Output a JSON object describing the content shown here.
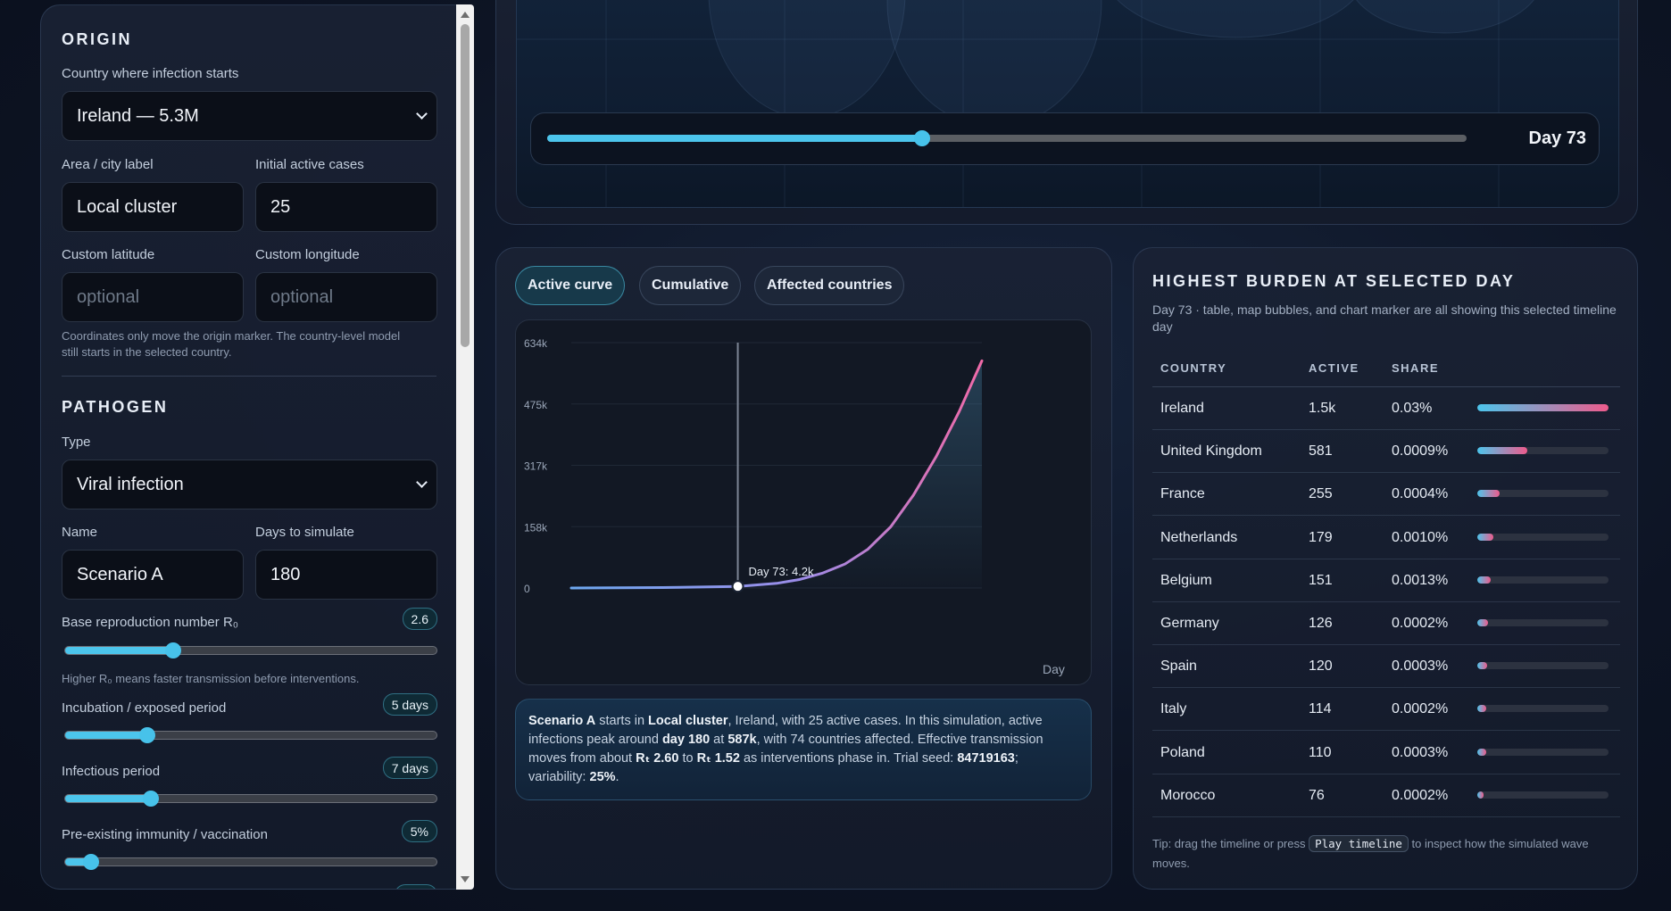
{
  "origin": {
    "title": "ORIGIN",
    "country_label": "Country where infection starts",
    "country_value": "Ireland — 5.3M",
    "area_label": "Area / city label",
    "area_value": "Local cluster",
    "cases_label": "Initial active cases",
    "cases_value": "25",
    "lat_label": "Custom latitude",
    "lat_placeholder": "optional",
    "lon_label": "Custom longitude",
    "lon_placeholder": "optional",
    "hint_line1": "Coordinates only move the origin marker. The country-level model",
    "hint_line2": "still starts in the selected country."
  },
  "pathogen": {
    "title": "PATHOGEN",
    "type_label": "Type",
    "type_value": "Viral infection",
    "name_label": "Name",
    "name_value": "Scenario A",
    "days_label": "Days to simulate",
    "days_value": "180",
    "r0_label": "Base reproduction number R₀",
    "r0_value": "2.6",
    "r0_fraction": 0.29,
    "r0_hint": "Higher R₀ means faster transmission before interventions.",
    "incubation_label": "Incubation / exposed period",
    "incubation_value": "5 days",
    "incubation_fraction": 0.22,
    "infectious_label": "Infectious period",
    "infectious_value": "7 days",
    "infectious_fraction": 0.23,
    "immunity_label": "Pre-existing immunity / vaccination",
    "immunity_value": "5%",
    "immunity_fraction": 0.07
  },
  "timeline": {
    "day_label": "Day 73",
    "fraction": 0.408
  },
  "tabs": [
    "Active curve",
    "Cumulative",
    "Affected countries"
  ],
  "chart_data": {
    "type": "line",
    "x": [
      0,
      20,
      40,
      60,
      73,
      90,
      100,
      110,
      120,
      130,
      140,
      150,
      160,
      170,
      180
    ],
    "values": [
      0,
      400,
      1200,
      2800,
      4200,
      12000,
      22000,
      38000,
      62000,
      100000,
      158000,
      240000,
      340000,
      455000,
      587000
    ],
    "yticks": [
      "634k",
      "475k",
      "317k",
      "158k",
      "0"
    ],
    "ylim": [
      0,
      634000
    ],
    "xlim": [
      0,
      180
    ],
    "xlabel": "Day",
    "marker_day": 73,
    "marker_label": "Day 73: 4.2k",
    "line_color_start": "#6ea8f0",
    "line_color_end": "#f06aa8"
  },
  "summary": {
    "scenario": "Scenario A",
    "t1": " starts in ",
    "area": "Local cluster",
    "t2": ", Ireland, with 25 active cases. In this simulation, active infections peak around ",
    "peak_day": "day 180",
    "t3": " at ",
    "peak_value": "587k",
    "t4": ", with 74 countries affected. Effective transmission moves from about ",
    "r_start": "Rₜ 2.60",
    "t5": " to ",
    "r_end": "Rₜ 1.52",
    "t6": " as interventions phase in. Trial seed: ",
    "seed": "84719163",
    "t7": "; variability: ",
    "variability": "25%",
    "t8": "."
  },
  "burden": {
    "title": "HIGHEST BURDEN AT SELECTED DAY",
    "subtitle": "Day 73 · table, map bubbles, and chart marker are all showing this selected timeline day",
    "col_country": "COUNTRY",
    "col_active": "ACTIVE",
    "col_share": "SHARE",
    "rows": [
      {
        "country": "Ireland",
        "active": "1.5k",
        "share": "0.03%",
        "bar": 1.0
      },
      {
        "country": "United Kingdom",
        "active": "581",
        "share": "0.0009%",
        "bar": 0.38
      },
      {
        "country": "France",
        "active": "255",
        "share": "0.0004%",
        "bar": 0.17
      },
      {
        "country": "Netherlands",
        "active": "179",
        "share": "0.0010%",
        "bar": 0.12
      },
      {
        "country": "Belgium",
        "active": "151",
        "share": "0.0013%",
        "bar": 0.1
      },
      {
        "country": "Germany",
        "active": "126",
        "share": "0.0002%",
        "bar": 0.08
      },
      {
        "country": "Spain",
        "active": "120",
        "share": "0.0003%",
        "bar": 0.075
      },
      {
        "country": "Italy",
        "active": "114",
        "share": "0.0002%",
        "bar": 0.07
      },
      {
        "country": "Poland",
        "active": "110",
        "share": "0.0003%",
        "bar": 0.068
      },
      {
        "country": "Morocco",
        "active": "76",
        "share": "0.0002%",
        "bar": 0.045
      }
    ],
    "tip_pre": "Tip: drag the timeline or press ",
    "tip_code": "Play timeline",
    "tip_post": " to inspect how the simulated wave moves."
  }
}
